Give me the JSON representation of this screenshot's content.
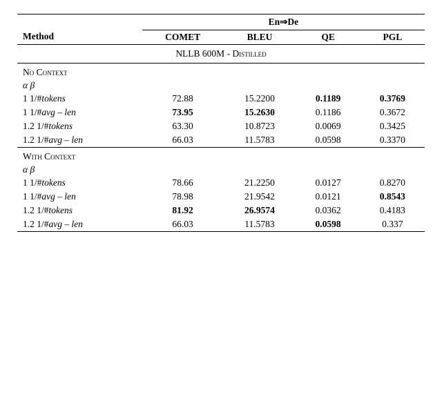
{
  "table": {
    "headers": {
      "method": "Method",
      "group": "En⇒De",
      "cols": [
        "COMET",
        "BLEU",
        "QE",
        "PGL"
      ]
    },
    "distilled_section": "NLLB 600M - Distilled",
    "sections": [
      {
        "label": "No Context",
        "alpha_beta": "α β",
        "rows": [
          {
            "method": "1 1/#tokens",
            "comet": "72.88",
            "bleu": "15.2200",
            "qe": "0.1189",
            "pgl": "0.3769",
            "bold": [
              "qe",
              "pgl"
            ]
          },
          {
            "method": "1 1/#avg – len",
            "comet": "73.95",
            "bleu": "15.2630",
            "qe": "0.1186",
            "pgl": "0.3672",
            "bold": [
              "comet",
              "bleu"
            ]
          },
          {
            "method": "1.2 1/#tokens",
            "comet": "63.30",
            "bleu": "10.8723",
            "qe": "0.0069",
            "pgl": "0.3425",
            "bold": []
          },
          {
            "method": "1.2 1/#avg – len",
            "comet": "66.03",
            "bleu": "11.5783",
            "qe": "0.0598",
            "pgl": "0.3370",
            "bold": []
          }
        ]
      },
      {
        "label": "With Context",
        "alpha_beta": "α β",
        "rows": [
          {
            "method": "1 1/#tokens",
            "comet": "78.66",
            "bleu": "21.2250",
            "qe": "0.0127",
            "pgl": "0.8270",
            "bold": []
          },
          {
            "method": "1 1/#avg – len",
            "comet": "78.98",
            "bleu": "21.9542",
            "qe": "0.0121",
            "pgl": "0.8543",
            "bold": [
              "pgl"
            ]
          },
          {
            "method": "1.2 1/#tokens",
            "comet": "81.92",
            "bleu": "26.9574",
            "qe": "0.0362",
            "pgl": "0.4183",
            "bold": [
              "comet",
              "bleu"
            ]
          },
          {
            "method": "1.2 1/#avg – len",
            "comet": "66.03",
            "bleu": "11.5783",
            "qe": "0.0598",
            "pgl": "0.337",
            "bold": [
              "qe"
            ]
          }
        ]
      }
    ]
  }
}
